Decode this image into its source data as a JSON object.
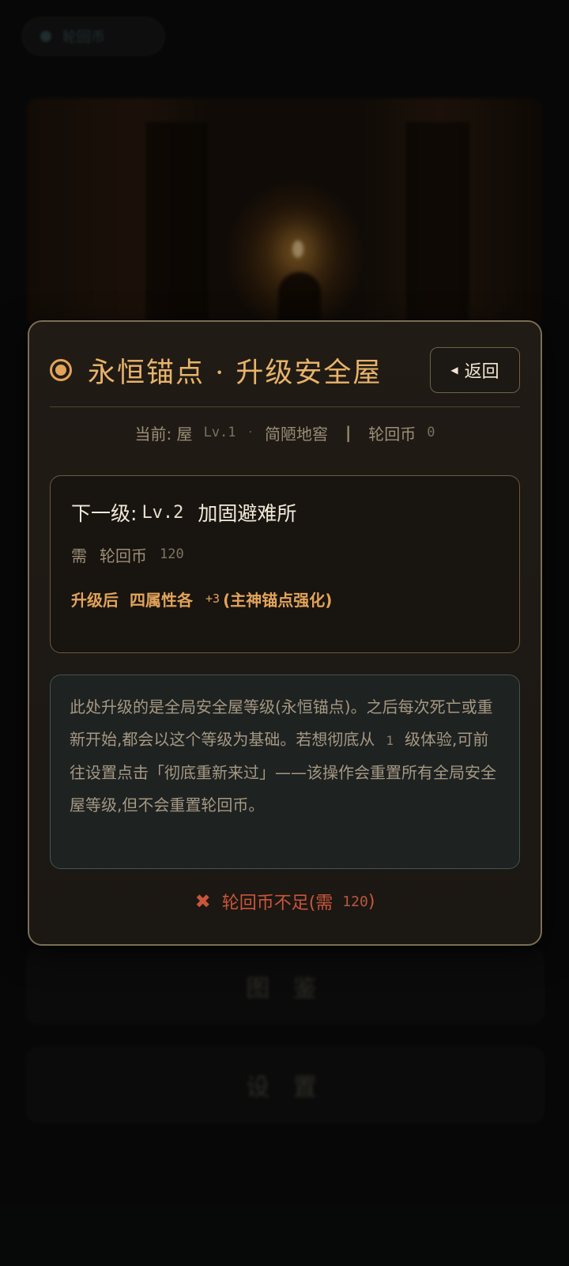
{
  "background": {
    "top_pill_label": "轮回币",
    "button_1_label": "图 鉴",
    "button_2_label": "设 置"
  },
  "modal": {
    "title": "永恒锚点 · 升级安全屋",
    "back_label": "返回",
    "status": {
      "current_label": "当前: 屋",
      "level": "Lv.1",
      "dot": "·",
      "house_name": "简陋地窖",
      "bar": "|",
      "coin_label": "轮回币",
      "coin_value": "0"
    },
    "next": {
      "prefix": "下一级:",
      "level": "Lv.2",
      "name": "加固避难所",
      "cost_prefix": "需",
      "cost_label": "轮回币",
      "cost_value": "120",
      "bonus_prefix": "升级后",
      "bonus_text": "四属性各",
      "bonus_value": "+3",
      "bonus_suffix": "(主神锚点强化)"
    },
    "info": {
      "text_1": "此处升级的是全局安全屋等级(永恒锚点)。之后每次死亡或重新开始,都会以这个等级为基础。若想彻底从",
      "num": "1",
      "text_2": "级体验,可前往设置点击「彻底重新来过」——该操作会重置所有全局安全屋等级,但不会重置轮回币。"
    },
    "error": {
      "icon": "✖",
      "text": "轮回币不足(需",
      "value": "120",
      "close": ")"
    }
  },
  "colors": {
    "accent": "#e2a35a",
    "error": "#c9553a",
    "border": "#7a6e54"
  }
}
